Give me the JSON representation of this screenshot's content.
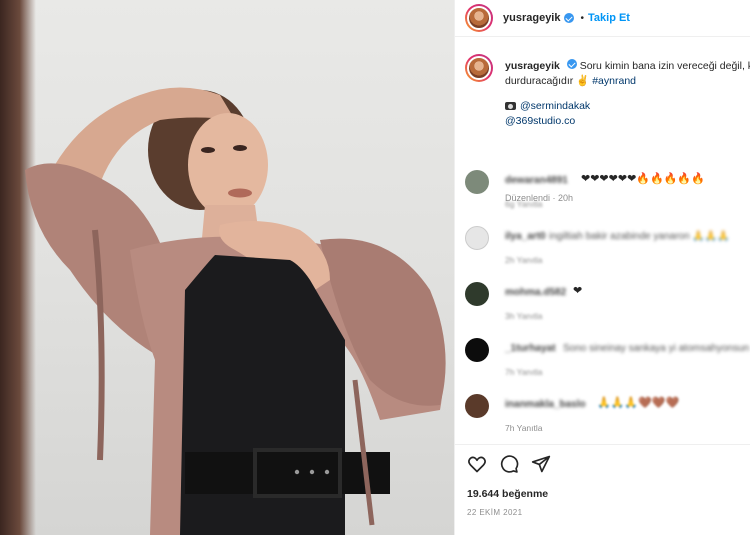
{
  "post": {
    "username": "yusrageyik",
    "follow_label": "Takip Et",
    "separator": "•"
  },
  "caption": {
    "username": "yusrageyik",
    "text_line1": "Soru kimin bana izin vereceği değil, kim",
    "text_line2": "durduracağıdır ✌",
    "hashtag": "#aynrand",
    "credit_photographer": "@sermindakak",
    "credit_studio": "@369studio.co",
    "edited": "Düzenlendi · 20h"
  },
  "comments": [
    {
      "name": "dewaran4891",
      "text": "",
      "hearts": "❤❤❤❤❤❤🔥🔥🔥🔥🔥",
      "meta": "6g    Yanıtla",
      "avatar_color": "#7d8a7a"
    },
    {
      "name": "ilya_art0",
      "text": "ingiltiah bakir azabinde yanaron 🙏🙏🙏",
      "hearts": "",
      "meta": "2h    Yanıtla",
      "avatar_color": "#dcdcdc"
    },
    {
      "name": "mohma.d582",
      "text": "",
      "hearts": "❤",
      "meta": "3h    Yanıtla",
      "avatar_color": "#2f3a2c"
    },
    {
      "name": "_1turhayat",
      "text": "Sono sineinay sankaya yi atomsahyonsun",
      "hearts": "",
      "meta": "7h    Yanıtla",
      "avatar_color": "#0c0c0c"
    },
    {
      "name": "inanmakla_baslo",
      "text": "",
      "hearts": "🙏🙏🙏🤎🤎🤎",
      "meta": "7h    Yanıtla",
      "avatar_color": "#5a3a2a"
    }
  ],
  "footer": {
    "likes": "19.644 beğenme",
    "date": "22 EKİM 2021"
  }
}
